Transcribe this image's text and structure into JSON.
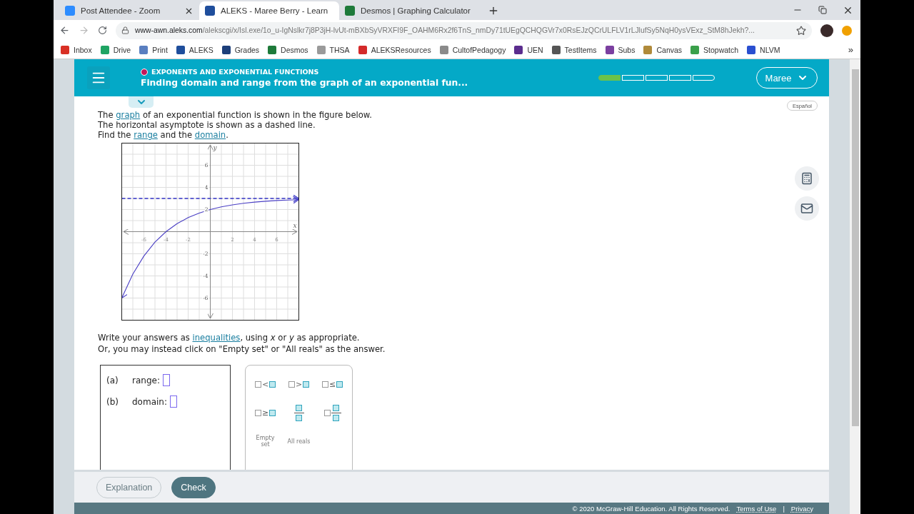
{
  "browser": {
    "tabs": [
      {
        "title": "Post Attendee - Zoom",
        "selected": false,
        "color": "#2d8cff"
      },
      {
        "title": "ALEKS - Maree Berry - Learn",
        "selected": true,
        "color": "#1f4e9c"
      },
      {
        "title": "Desmos | Graphing Calculator",
        "selected": false,
        "color": "#1e7a3a"
      }
    ],
    "url": {
      "host": "www-awn.aleks.com",
      "path": "/alekscgi/x/Isl.exe/1o_u-IgNslkr7j8P3jH-lvUt-mBXbSyVRXFI9F_OAHM6Rx2f6TnS_nmDy71tUEgQCHQGVr7x0RsEJzQCrULFLV1rLJlufSy5NqH0ysVExz_StM8hJekh?..."
    },
    "bookmarks": [
      {
        "label": "Inbox",
        "color": "#d93025"
      },
      {
        "label": "Drive",
        "color": "#1fa463"
      },
      {
        "label": "Print",
        "color": "#5a7fc0"
      },
      {
        "label": "ALEKS",
        "color": "#1f4e9c"
      },
      {
        "label": "Grades",
        "color": "#1d3f7a"
      },
      {
        "label": "Desmos",
        "color": "#1e7a3a"
      },
      {
        "label": "THSA",
        "color": "#9a9a9a"
      },
      {
        "label": "ALEKSResources",
        "color": "#d42a2a"
      },
      {
        "label": "CultofPedagogy",
        "color": "#8a8a8a"
      },
      {
        "label": "UEN",
        "color": "#5b2d8e"
      },
      {
        "label": "TestItems",
        "color": "#555555"
      },
      {
        "label": "Subs",
        "color": "#7b3fa0"
      },
      {
        "label": "Canvas",
        "color": "#b08a3a"
      },
      {
        "label": "Stopwatch",
        "color": "#3aa04a"
      },
      {
        "label": "NLVM",
        "color": "#2a4fd0"
      }
    ],
    "more": "»"
  },
  "header": {
    "topic": "EXPONENTS AND EXPONENTIAL FUNCTIONS",
    "title": "Finding domain and range from the graph of an exponential fun...",
    "progress": [
      {
        "filled": true
      },
      {
        "filled": false
      },
      {
        "filled": false
      },
      {
        "filled": false
      },
      {
        "filled": false
      }
    ],
    "user": "Maree"
  },
  "language_button": "Español",
  "instructions": [
    [
      {
        "text": "The ",
        "link": false
      },
      {
        "text": "graph",
        "link": true
      },
      {
        "text": " of an exponential function is shown in the figure below.",
        "link": false
      }
    ],
    [
      {
        "text": "The horizontal asymptote is shown as a dashed line.",
        "link": false
      }
    ],
    [
      {
        "text": "Find the ",
        "link": false
      },
      {
        "text": "range",
        "link": true
      },
      {
        "text": " and the ",
        "link": false
      },
      {
        "text": "domain",
        "link": true
      },
      {
        "text": ".",
        "link": false
      }
    ]
  ],
  "graph": {
    "chart_data": {
      "type": "line",
      "xlabel": "x",
      "ylabel": "y",
      "x": [
        -8,
        -7,
        -6,
        -5,
        -4,
        -3,
        -2,
        -1,
        0,
        1,
        2,
        3,
        4,
        5,
        6,
        7,
        8
      ],
      "grid": true,
      "series": [
        {
          "color": "#4a3fc4",
          "line_style": "solid",
          "values": [
            -6,
            -3.84,
            -2.2,
            -0.95,
            0,
            0.72,
            1.27,
            1.68,
            2,
            2.24,
            2.42,
            2.56,
            2.67,
            2.75,
            2.81,
            2.85,
            2.89
          ]
        },
        {
          "color": "#3535c8",
          "line_style": "dashed",
          "values": [
            3,
            3,
            3,
            3,
            3,
            3,
            3,
            3,
            3,
            3,
            3,
            3,
            3,
            3,
            3,
            3,
            3
          ]
        }
      ],
      "xlim": [
        -8,
        8
      ],
      "ylim": [
        -8,
        8
      ],
      "xticks": [
        -6,
        -4,
        -2,
        2,
        4,
        6
      ],
      "yticks": [
        -6,
        -4,
        -2,
        2,
        4,
        6
      ]
    }
  },
  "answer_instructions": [
    [
      {
        "text": "Write your answers as ",
        "link": false
      },
      {
        "text": "inequalities",
        "link": true
      },
      {
        "text": ", using *x* or *y* as appropriate.",
        "link": false
      }
    ],
    [
      {
        "text": "Or, you may instead click on \"Empty set\" or \"All reals\" as the answer.",
        "link": false
      }
    ]
  ],
  "answers": [
    {
      "label": "(a)",
      "name": "range:"
    },
    {
      "label": "(b)",
      "name": "domain:"
    }
  ],
  "keypad": [
    {
      "kind": "relation",
      "symbol": "<"
    },
    {
      "kind": "relation",
      "symbol": ">"
    },
    {
      "kind": "relation",
      "symbol": "≤"
    },
    {
      "kind": "relation",
      "symbol": "≥"
    },
    {
      "kind": "fraction"
    },
    {
      "kind": "mixed"
    },
    {
      "kind": "text",
      "label": "Empty set"
    },
    {
      "kind": "text",
      "label": "All reals"
    }
  ],
  "footer": {
    "buttons": [
      {
        "label": "Explanation",
        "kind": "secondary"
      },
      {
        "label": "Check",
        "kind": "primary"
      }
    ],
    "copyright": "© 2020 McGraw-Hill Education. All Rights Reserved.",
    "links": [
      "Terms of Use",
      "Privacy"
    ],
    "separator": "|"
  }
}
